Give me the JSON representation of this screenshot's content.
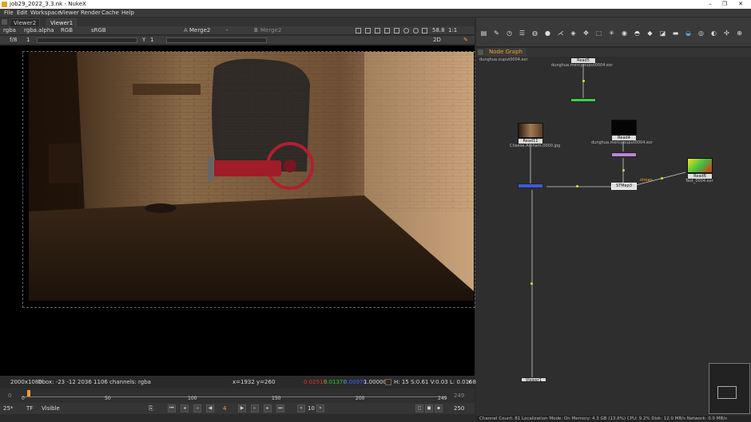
{
  "window": {
    "title": "job29_2022_3.3.nk - NukeX",
    "buttons": [
      "–",
      "❐",
      "✕"
    ]
  },
  "menu": [
    "File",
    "Edit",
    "Workspace",
    "Viewer",
    "Render",
    "Cache",
    "Help"
  ],
  "viewer_tabs": [
    "Viewer2",
    "Viewer1"
  ],
  "viewer_toolbar": {
    "channels": "rgba",
    "alpha": "rgba.alpha",
    "colorspace_rgb": "RGB",
    "lut": "sRGB",
    "input_a_label": "A",
    "input_a": "Merge2",
    "wipe": "-",
    "input_b_label": "B",
    "input_b": "Merge2",
    "zoom": "58.8",
    "ratio": "1:1",
    "view_mode": "2D",
    "fstop": "f/8",
    "frame_prefix": "1",
    "y_label": "Y",
    "y_value": "1"
  },
  "status": {
    "format": "2000x1080",
    "bbox": "bbox: -23 -12 2036 1106 channels: rgba",
    "coords": "x=1932 y=260",
    "r": "0.02519",
    "g": "0.01370",
    "b": "0.00970",
    "a": "1.00000",
    "hsvl": "H: 15 S:0.61 V:0.03  L: 0.01586"
  },
  "timeline": {
    "start": "0",
    "ticks": [
      "0",
      "50",
      "100",
      "150",
      "200",
      "249"
    ],
    "end": "249",
    "current": "4"
  },
  "playbar": {
    "fps": "25*",
    "tf": "TF",
    "visible": "Visible",
    "step": "10",
    "end_field": "250"
  },
  "node_graph": {
    "tab": "Node Graph",
    "nodes": {
      "read5": "Read5",
      "read5_path": "dunghua.mercy.ouput0004.exr",
      "read11": "Read11",
      "read11_path": "Cheese.Arkham.0000.jpg",
      "read4": "Read4",
      "read4_path": "dunghua.mercy.ouput0004.exr",
      "read6": "Read6",
      "read6_path": "Test_0004.exr",
      "stmap": "STMap3",
      "stmap_label": "stmap",
      "viewer": "Viewer1",
      "top_read_path": "dunghua.ouput0004.exr"
    }
  },
  "bottom_status": "Channel Count: 81  Localization Mode: On  Memory: 4.3 GB (13.6%)  CPU: 9.2%  Disk: 12.0 MB/s  Network: 0.0 MB/s",
  "colors": {
    "accent": "#f0a030",
    "node_select": "#ffffff",
    "green_node": "#3fcf3f",
    "blue_node": "#3b5bd8",
    "purple_node": "#c080d8"
  }
}
